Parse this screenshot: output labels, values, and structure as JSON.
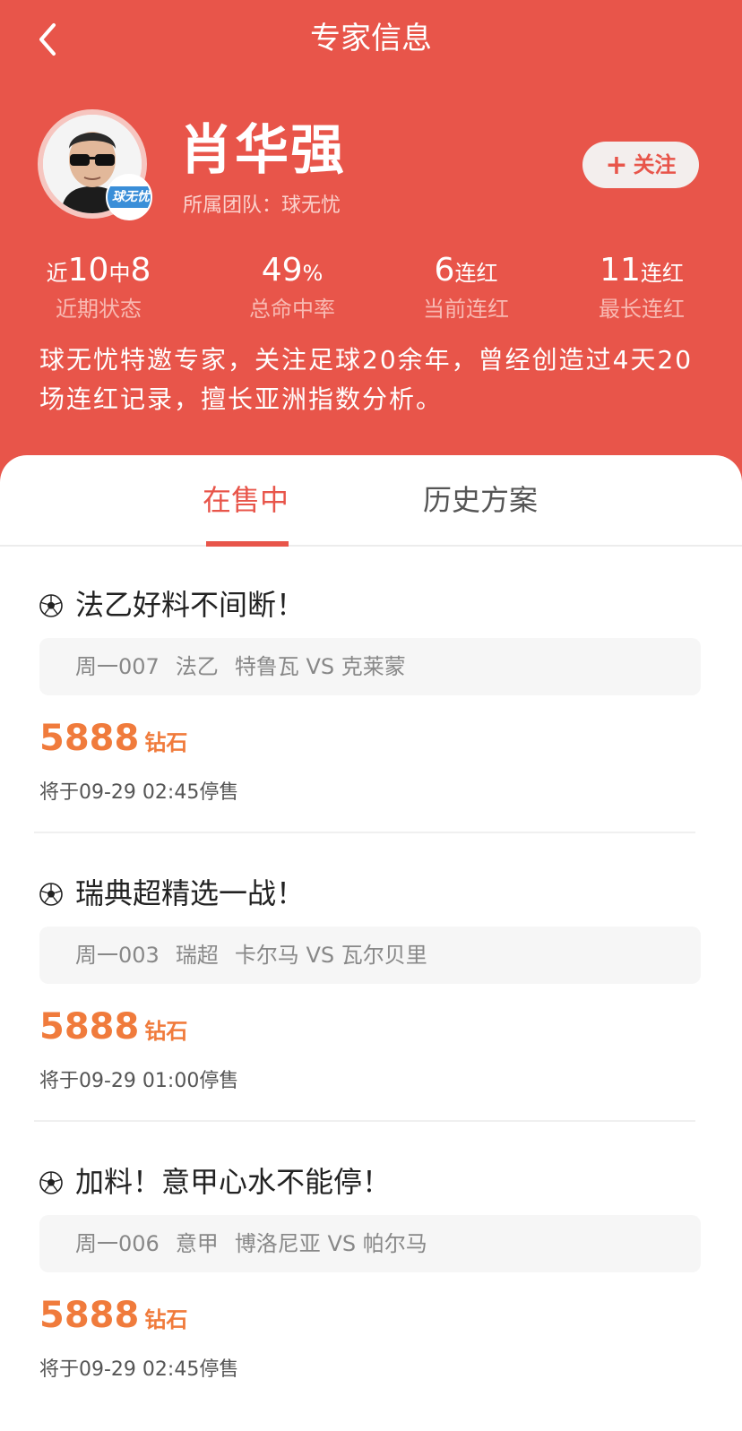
{
  "header": {
    "title": "专家信息",
    "back_icon": "chevron-left-icon",
    "background_color": "#e8554a"
  },
  "expert": {
    "name": "肖华强",
    "team_label": "所属团队：球无忧",
    "team_badge": "球无忧",
    "follow_label": "关注",
    "follow_icon": "plus-icon"
  },
  "stats": {
    "recent": {
      "prefix": "近",
      "count": "10",
      "mid": "中",
      "hits": "8",
      "label": "近期状态"
    },
    "hit_rate": {
      "value": "49",
      "unit": "%",
      "label": "总命中率"
    },
    "current_streak": {
      "value": "6",
      "unit": "连红",
      "label": "当前连红"
    },
    "longest_streak": {
      "value": "11",
      "unit": "连红",
      "label": "最长连红"
    }
  },
  "intro": "球无忧特邀专家，关注足球20余年，曾经创造过4天20场连红记录，擅长亚洲指数分析。",
  "tabs": {
    "on_sale": "在售中",
    "history": "历史方案"
  },
  "plans": [
    {
      "title": "法乙好料不间断！",
      "match_code": "周一007",
      "league": "法乙",
      "teams": "特鲁瓦 VS 克莱蒙",
      "price": "5888",
      "currency": "钻石",
      "deadline": "将于09-29 02:45停售"
    },
    {
      "title": "瑞典超精选一战！",
      "match_code": "周一003",
      "league": "瑞超",
      "teams": "卡尔马 VS 瓦尔贝里",
      "price": "5888",
      "currency": "钻石",
      "deadline": "将于09-29 01:00停售"
    },
    {
      "title": "加料！意甲心水不能停！",
      "match_code": "周一006",
      "league": "意甲",
      "teams": "博洛尼亚 VS 帕尔马",
      "price": "5888",
      "currency": "钻石",
      "deadline": "将于09-29 02:45停售"
    }
  ],
  "colors": {
    "accent": "#e8554a",
    "price": "#f07b3c"
  }
}
